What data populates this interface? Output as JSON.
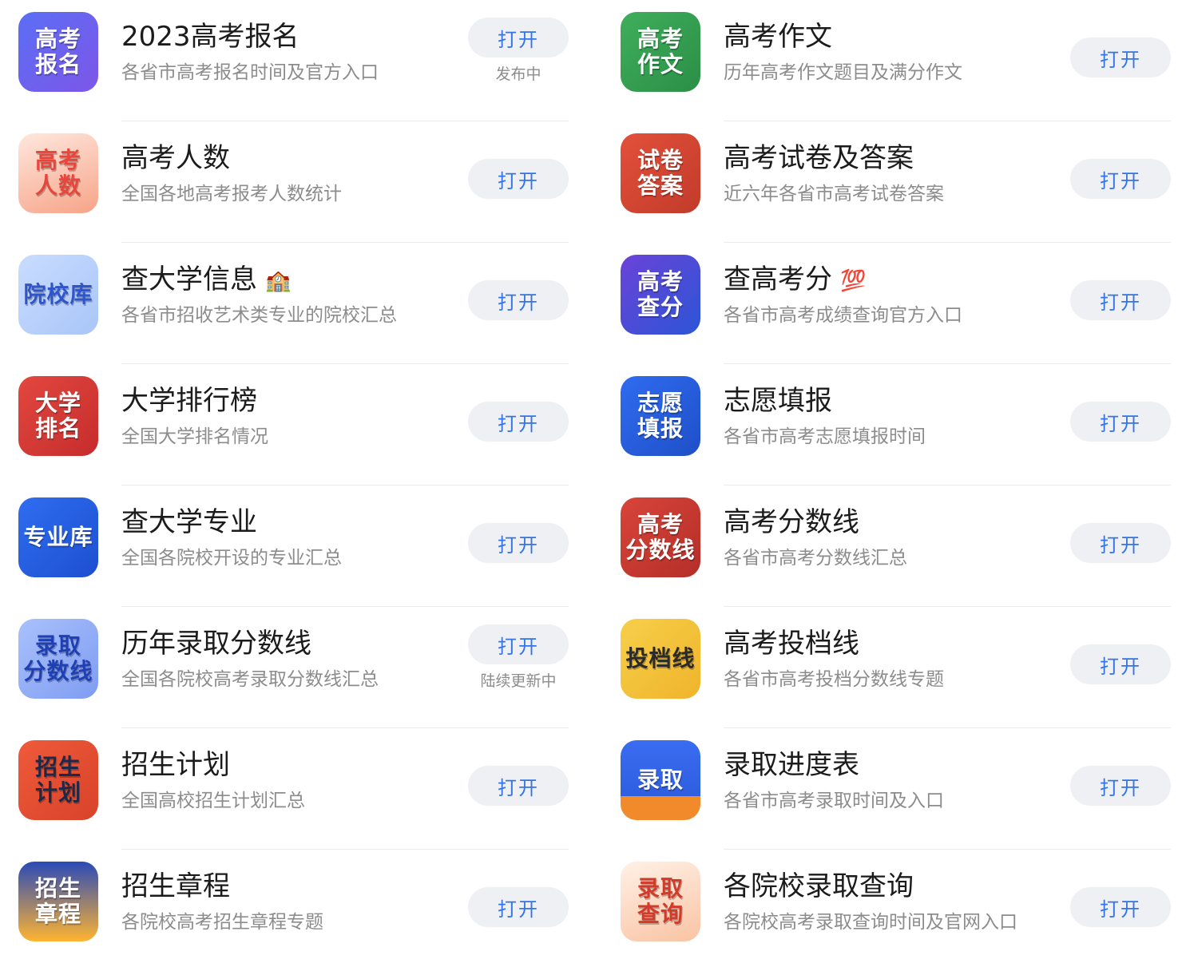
{
  "button_label": "打开",
  "left_column": [
    {
      "icon_name": "gaokao-baoming-app-icon",
      "icon_text": "高考\n报名",
      "icon_bg": "linear-gradient(135deg,#5b6ef5,#7d56e8)",
      "title": "2023高考报名",
      "emoji": "",
      "subtitle": "各省市高考报名时间及官方入口",
      "note": "发布中"
    },
    {
      "icon_name": "gaokao-renshu-app-icon",
      "icon_text": "高考\n人数",
      "icon_bg": "linear-gradient(160deg,#ffe7dd,#f6a488)",
      "icon_text_color": "#e8453c",
      "title": "高考人数",
      "emoji": "",
      "subtitle": "全国各地高考报考人数统计",
      "note": ""
    },
    {
      "icon_name": "yuanxiaoku-app-icon",
      "icon_text": "院校库",
      "icon_bg": "linear-gradient(135deg,#c9dcff,#a9c6f7)",
      "icon_text_color": "#2f55c9",
      "title": "查大学信息",
      "emoji": "🏫",
      "subtitle": "各省市招收艺术类专业的院校汇总",
      "note": ""
    },
    {
      "icon_name": "daxue-paiming-app-icon",
      "icon_text": "大学\n排名",
      "icon_bg": "linear-gradient(135deg,#e2483f,#c62c2c)",
      "title": "大学排行榜",
      "emoji": "",
      "subtitle": "全国大学排名情况",
      "note": ""
    },
    {
      "icon_name": "zhuanyeku-app-icon",
      "icon_text": "专业库",
      "icon_bg": "linear-gradient(135deg,#2f6df0,#1d4fd0)",
      "title": "查大学专业",
      "emoji": "",
      "subtitle": "全国各院校开设的专业汇总",
      "note": ""
    },
    {
      "icon_name": "luqu-fenshuxian-app-icon",
      "icon_text": "录取\n分数线",
      "icon_bg": "linear-gradient(135deg,#a9c1fb,#7f9cf2)",
      "icon_text_color": "#1f3fb5",
      "title": "历年录取分数线",
      "emoji": "",
      "subtitle": "全国各院校高考录取分数线汇总",
      "note": "陆续更新中"
    },
    {
      "icon_name": "zhaosheng-jihua-app-icon",
      "icon_text": "招生\n计划",
      "icon_bg": "linear-gradient(135deg,#ef5a3a,#d8432a)",
      "icon_text_color": "#1b2a4a",
      "title": "招生计划",
      "emoji": "",
      "subtitle": "全国高校招生计划汇总",
      "note": ""
    },
    {
      "icon_name": "zhaosheng-zhangcheng-app-icon",
      "icon_text": "招生\n章程",
      "icon_bg": "linear-gradient(180deg,#2a4ab8,#ffb431)",
      "title": "招生章程",
      "emoji": "",
      "subtitle": "各院校高考招生章程专题",
      "note": ""
    }
  ],
  "right_column": [
    {
      "icon_name": "gaokao-zuowen-app-icon",
      "icon_text": "高考\n作文",
      "icon_bg": "linear-gradient(135deg,#3fae5c,#2b8f46)",
      "title": "高考作文",
      "emoji": "",
      "subtitle": "历年高考作文题目及满分作文",
      "note": ""
    },
    {
      "icon_name": "shijuan-daan-app-icon",
      "icon_text": "试卷\n答案",
      "icon_bg": "linear-gradient(135deg,#e2503a,#c23b2a)",
      "title": "高考试卷及答案",
      "emoji": "",
      "subtitle": "近六年各省市高考试卷答案",
      "note": ""
    },
    {
      "icon_name": "gaokao-chafen-app-icon",
      "icon_text": "高考\n查分",
      "icon_bg": "linear-gradient(135deg,#6b43d8,#2c55d6)",
      "title": "查高考分",
      "emoji": "💯",
      "subtitle": "各省市高考成绩查询官方入口",
      "note": ""
    },
    {
      "icon_name": "zhiyuan-tianbao-app-icon",
      "icon_text": "志愿\n填报",
      "icon_bg": "linear-gradient(135deg,#2f6cf0,#1f4fc8)",
      "title": "志愿填报",
      "emoji": "",
      "subtitle": "各省市高考志愿填报时间",
      "note": ""
    },
    {
      "icon_name": "gaokao-fenshuxian-app-icon",
      "icon_text": "高考\n分数线",
      "icon_bg": "linear-gradient(135deg,#d8453a,#b42e28)",
      "title": "高考分数线",
      "emoji": "",
      "subtitle": "各省市高考分数线汇总",
      "note": ""
    },
    {
      "icon_name": "toudangxian-app-icon",
      "icon_text": "投档线",
      "icon_bg": "linear-gradient(135deg,#f7cf4a,#efb42b)",
      "icon_text_color": "#2a2a2a",
      "title": "高考投档线",
      "emoji": "",
      "subtitle": "各省市高考投档分数线专题",
      "note": ""
    },
    {
      "icon_name": "luqu-jindu-app-icon",
      "icon_text": "录取",
      "icon_bg": "linear-gradient(180deg,#3a6cf2,#2f5fe0 70%,#f08a2a 70%)",
      "title": "录取进度表",
      "emoji": "",
      "subtitle": "各省市高考录取时间及入口",
      "note": ""
    },
    {
      "icon_name": "luqu-chaxun-app-icon",
      "icon_text": "录取\n查询",
      "icon_bg": "linear-gradient(160deg,#fff1e6,#f9c3a3)",
      "icon_text_color": "#d23a2a",
      "title": "各院校录取查询",
      "emoji": "",
      "subtitle": "各院校高考录取查询时间及官网入口",
      "note": ""
    }
  ]
}
